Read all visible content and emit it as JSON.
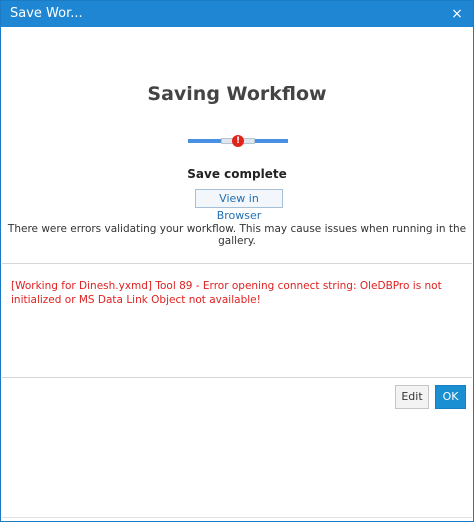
{
  "window": {
    "title": "Save Wor...",
    "close_glyph": "×"
  },
  "main": {
    "heading": "Saving Workflow",
    "progress": {
      "state": "error",
      "error_glyph": "!"
    },
    "status": "Save complete",
    "view_button_label": "View in Browser",
    "warning_text": "There were errors validating your workflow. This may cause issues when running in the gallery."
  },
  "errors": {
    "message": "[Working for Dinesh.yxmd] Tool 89 - Error opening connect string: OleDBPro is not initialized or MS Data Link Object not available!"
  },
  "footer": {
    "edit_label": "Edit",
    "ok_label": "OK"
  },
  "colors": {
    "titlebar": "#1f86d3",
    "error": "#e02020",
    "ok_button": "#1a8fd1"
  },
  "icons": {
    "close": "close-icon",
    "progress_error": "error-icon"
  }
}
